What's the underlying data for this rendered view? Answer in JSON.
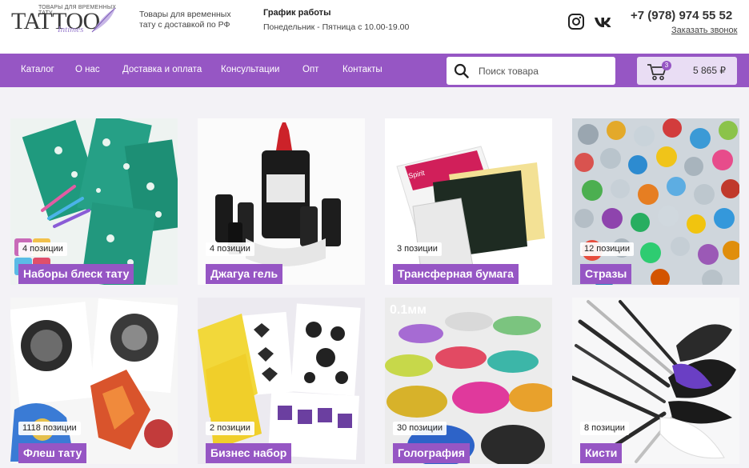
{
  "header": {
    "logo_top": "ТОВАРЫ ДЛЯ ВРЕМЕННЫХ ТАТУ",
    "logo_main": "TATTOO",
    "logo_sub": "Intimes",
    "tagline": "Товары для временных тату с доставкой по РФ",
    "schedule_title": "График работы",
    "schedule_text": "Понедельник - Пятница с 10.00-19.00",
    "phone": "+7 (978) 974 55 52",
    "callback": "Заказать звонок"
  },
  "nav": {
    "items": [
      "Каталог",
      "О нас",
      "Доставка и оплата",
      "Консультации",
      "Опт",
      "Контакты"
    ]
  },
  "search": {
    "placeholder": "Поиск товара"
  },
  "cart": {
    "count": "3",
    "total": "5 865 ₽"
  },
  "colors": {
    "accent": "#9656c4",
    "cart_bg": "#e9ddf4",
    "page_bg": "#f3f2f6"
  },
  "categories": [
    {
      "count": "4 позиции",
      "name": "Наборы блеск тату"
    },
    {
      "count": "4 позиции",
      "name": "Джагуа гель"
    },
    {
      "count": "3 позиции",
      "name": "Трансферная бумага"
    },
    {
      "count": "12 позиции",
      "name": "Стразы"
    },
    {
      "count": "1118 позиции",
      "name": "Флеш тату"
    },
    {
      "count": "2 позиции",
      "name": "Бизнес набор"
    },
    {
      "count": "30 позиции",
      "name": "Голография"
    },
    {
      "count": "8 позиции",
      "name": "Кисти"
    }
  ],
  "image_texts": {
    "glitter_label": "0.1мм",
    "paper_brand": "Spirit"
  },
  "icons": [
    "instagram-icon",
    "vk-icon",
    "search-icon",
    "cart-icon"
  ]
}
